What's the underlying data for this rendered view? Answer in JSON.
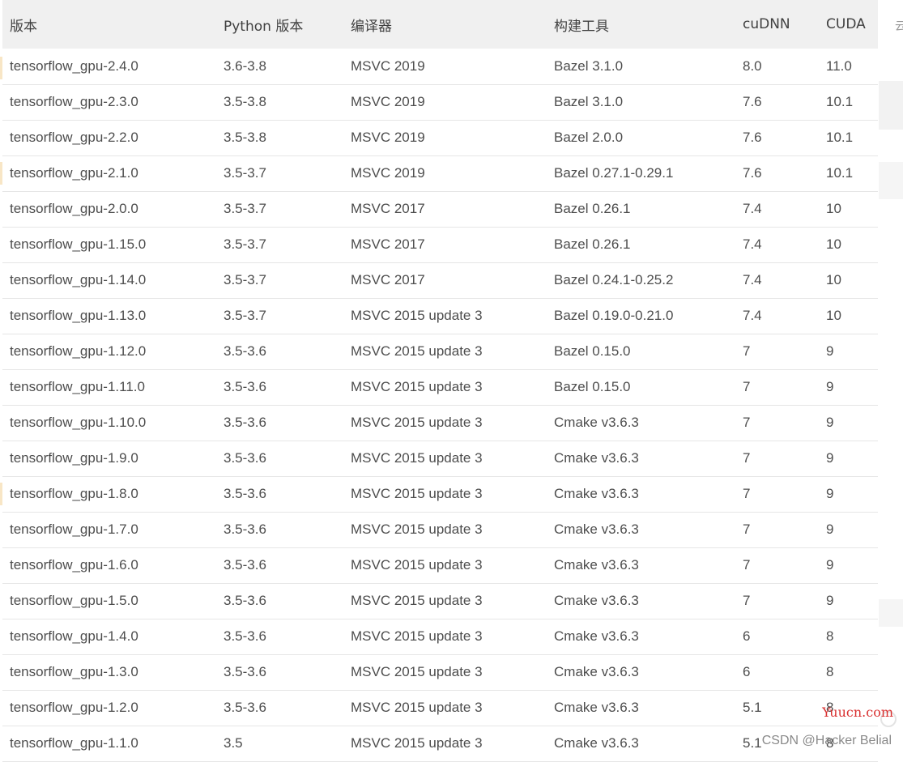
{
  "table": {
    "headers": [
      "版本",
      "Python 版本",
      "编译器",
      "构建工具",
      "cuDNN",
      "CUDA"
    ],
    "rows": [
      [
        "tensorflow_gpu-2.4.0",
        "3.6-3.8",
        "MSVC 2019",
        "Bazel 3.1.0",
        "8.0",
        "11.0"
      ],
      [
        "tensorflow_gpu-2.3.0",
        "3.5-3.8",
        "MSVC 2019",
        "Bazel 3.1.0",
        "7.6",
        "10.1"
      ],
      [
        "tensorflow_gpu-2.2.0",
        "3.5-3.8",
        "MSVC 2019",
        "Bazel 2.0.0",
        "7.6",
        "10.1"
      ],
      [
        "tensorflow_gpu-2.1.0",
        "3.5-3.7",
        "MSVC 2019",
        "Bazel 0.27.1-0.29.1",
        "7.6",
        "10.1"
      ],
      [
        "tensorflow_gpu-2.0.0",
        "3.5-3.7",
        "MSVC 2017",
        "Bazel 0.26.1",
        "7.4",
        "10"
      ],
      [
        "tensorflow_gpu-1.15.0",
        "3.5-3.7",
        "MSVC 2017",
        "Bazel 0.26.1",
        "7.4",
        "10"
      ],
      [
        "tensorflow_gpu-1.14.0",
        "3.5-3.7",
        "MSVC 2017",
        "Bazel 0.24.1-0.25.2",
        "7.4",
        "10"
      ],
      [
        "tensorflow_gpu-1.13.0",
        "3.5-3.7",
        "MSVC 2015 update 3",
        "Bazel 0.19.0-0.21.0",
        "7.4",
        "10"
      ],
      [
        "tensorflow_gpu-1.12.0",
        "3.5-3.6",
        "MSVC 2015 update 3",
        "Bazel 0.15.0",
        "7",
        "9"
      ],
      [
        "tensorflow_gpu-1.11.0",
        "3.5-3.6",
        "MSVC 2015 update 3",
        "Bazel 0.15.0",
        "7",
        "9"
      ],
      [
        "tensorflow_gpu-1.10.0",
        "3.5-3.6",
        "MSVC 2015 update 3",
        "Cmake v3.6.3",
        "7",
        "9"
      ],
      [
        "tensorflow_gpu-1.9.0",
        "3.5-3.6",
        "MSVC 2015 update 3",
        "Cmake v3.6.3",
        "7",
        "9"
      ],
      [
        "tensorflow_gpu-1.8.0",
        "3.5-3.6",
        "MSVC 2015 update 3",
        "Cmake v3.6.3",
        "7",
        "9"
      ],
      [
        "tensorflow_gpu-1.7.0",
        "3.5-3.6",
        "MSVC 2015 update 3",
        "Cmake v3.6.3",
        "7",
        "9"
      ],
      [
        "tensorflow_gpu-1.6.0",
        "3.5-3.6",
        "MSVC 2015 update 3",
        "Cmake v3.6.3",
        "7",
        "9"
      ],
      [
        "tensorflow_gpu-1.5.0",
        "3.5-3.6",
        "MSVC 2015 update 3",
        "Cmake v3.6.3",
        "7",
        "9"
      ],
      [
        "tensorflow_gpu-1.4.0",
        "3.5-3.6",
        "MSVC 2015 update 3",
        "Cmake v3.6.3",
        "6",
        "8"
      ],
      [
        "tensorflow_gpu-1.3.0",
        "3.5-3.6",
        "MSVC 2015 update 3",
        "Cmake v3.6.3",
        "6",
        "8"
      ],
      [
        "tensorflow_gpu-1.2.0",
        "3.5-3.6",
        "MSVC 2015 update 3",
        "Cmake v3.6.3",
        "5.1",
        "8"
      ],
      [
        "tensorflow_gpu-1.1.0",
        "3.5",
        "MSVC 2015 update 3",
        "Cmake v3.6.3",
        "5.1",
        "8"
      ]
    ]
  },
  "watermarks": {
    "site": "Yuucn.com",
    "author": "CSDN @Hacker Belial"
  },
  "edge": {
    "cut_char": "云"
  },
  "colors": {
    "header_bg": "#f0f0f0",
    "row_border": "#e6e6e6",
    "watermark_site": "#d93030"
  }
}
